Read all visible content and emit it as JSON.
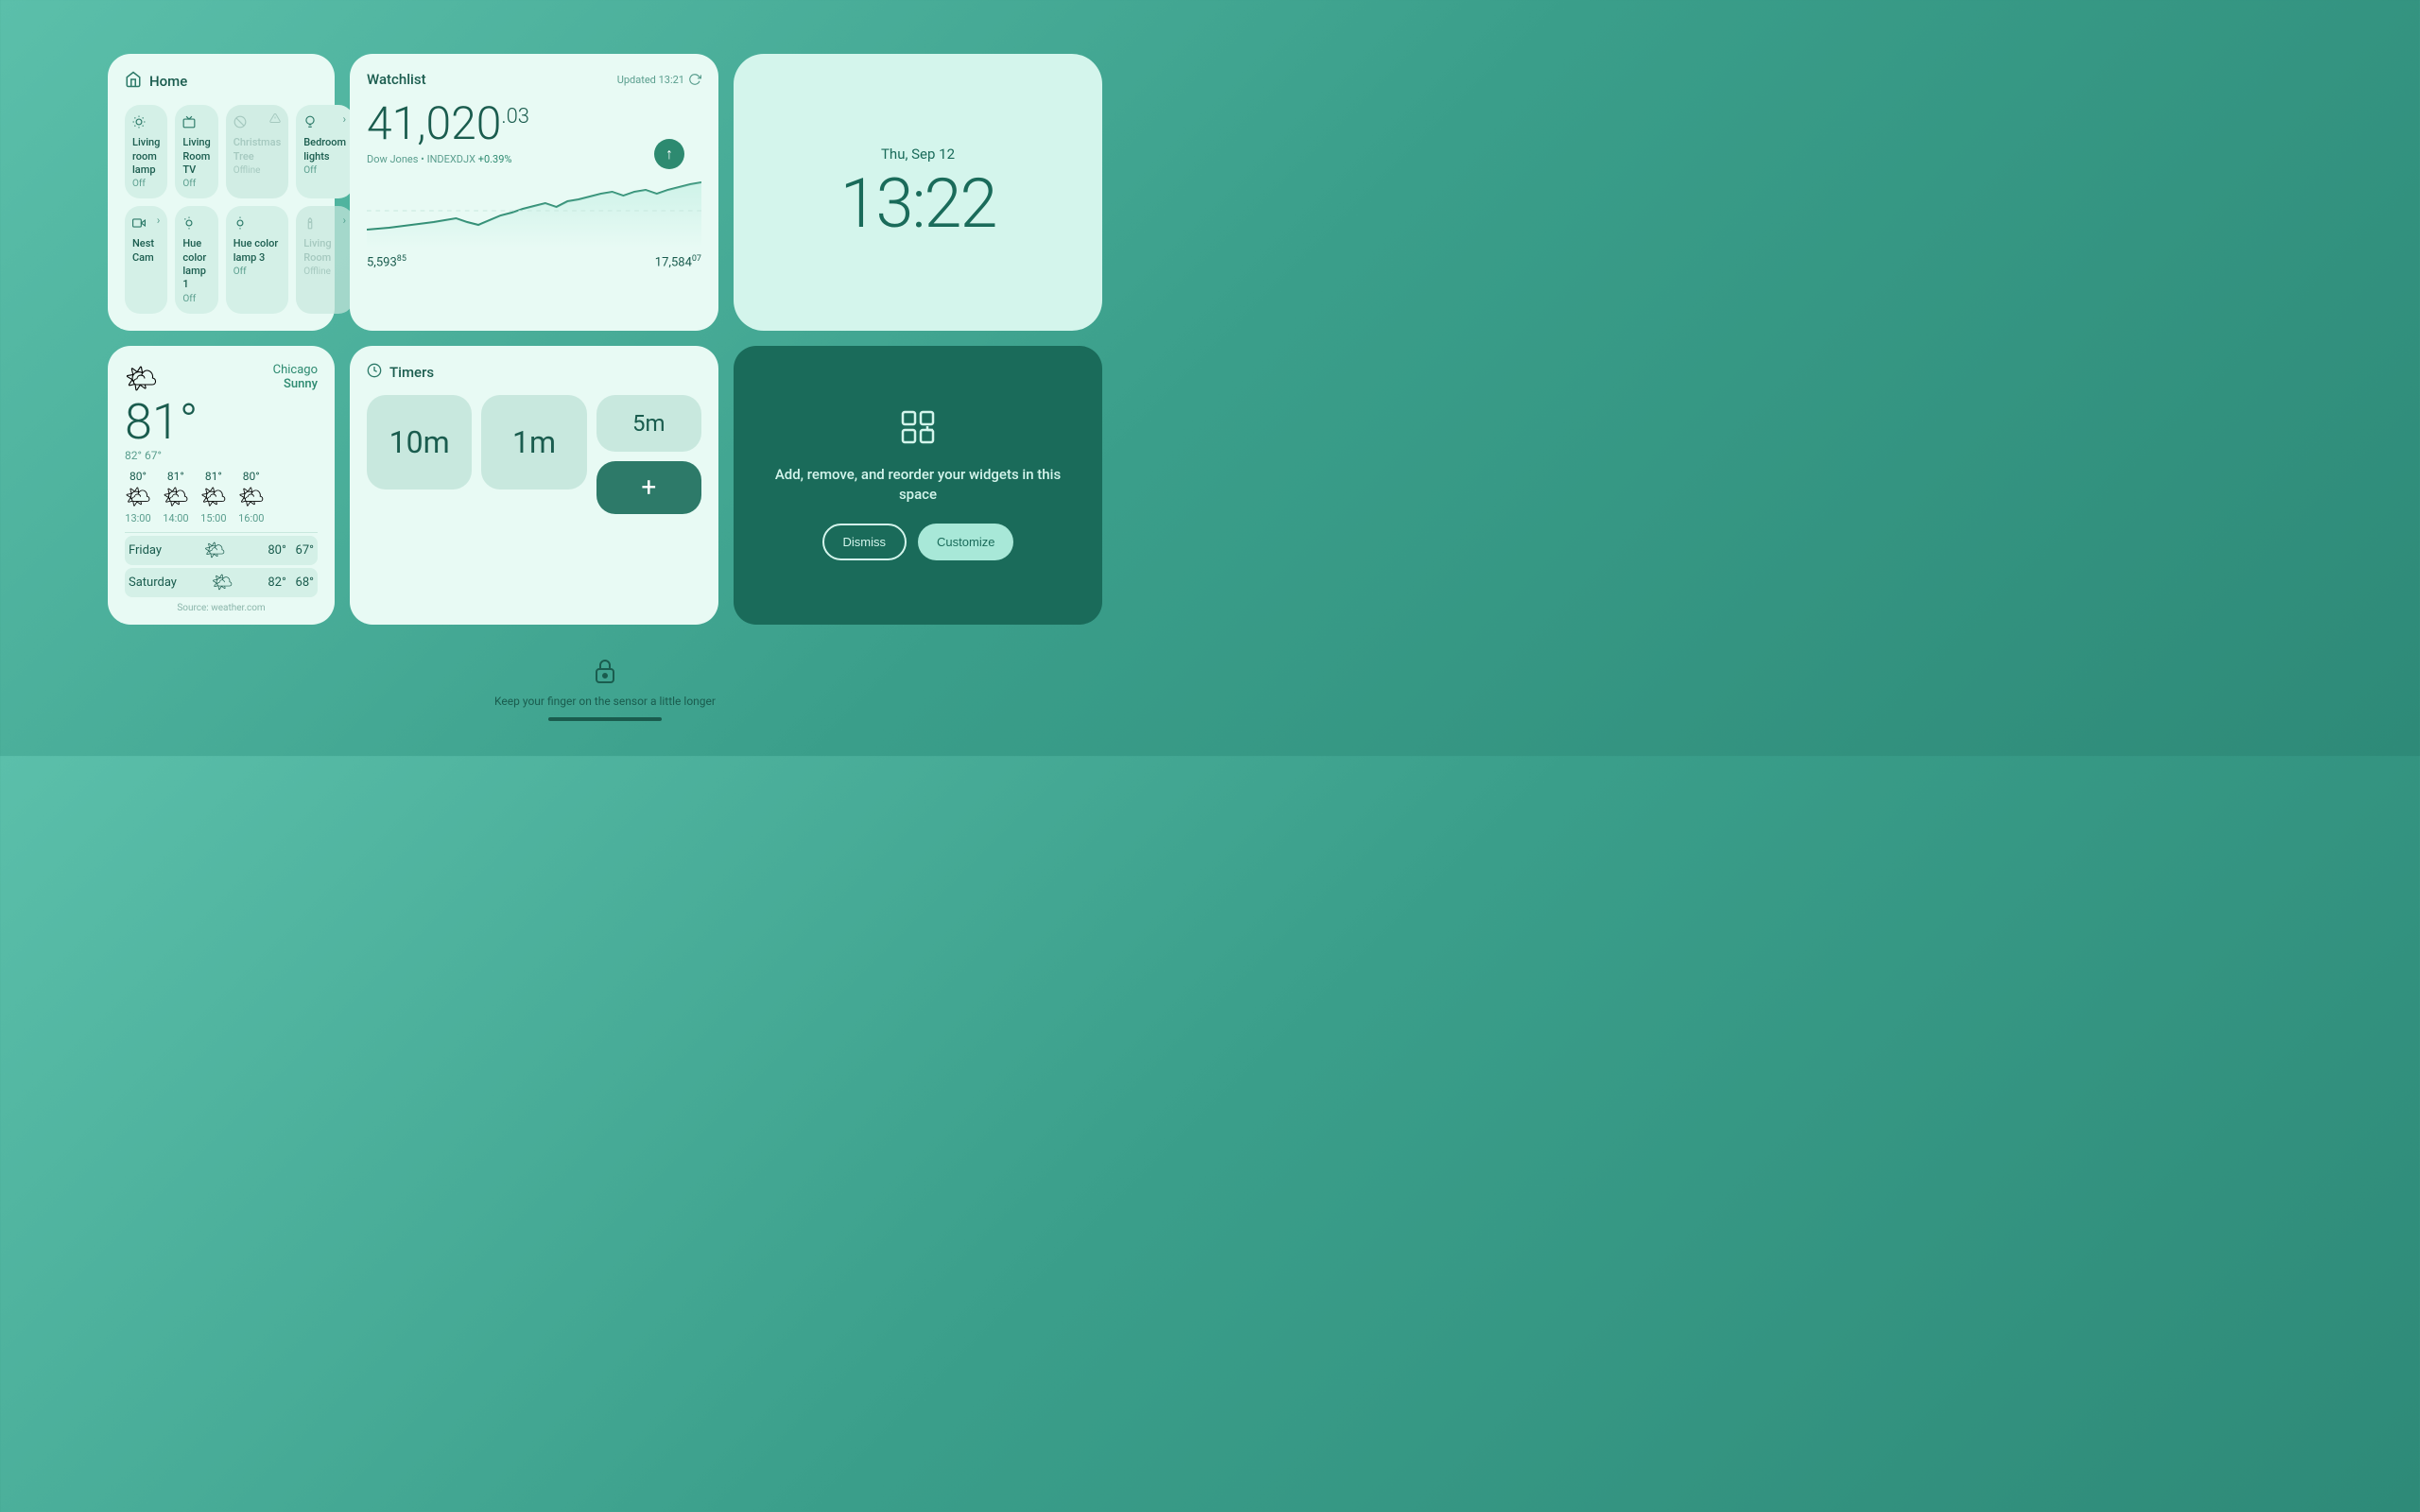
{
  "clock": {
    "date": "Thu, Sep 12",
    "time": "13:22"
  },
  "home": {
    "title": "Home",
    "icon": "🏠",
    "items": [
      {
        "name": "Living room lamp",
        "status": "Off",
        "icon": "💡",
        "offline": false,
        "warning": false,
        "more": false
      },
      {
        "name": "Living Room TV",
        "status": "Off",
        "icon": "📺",
        "offline": false,
        "warning": false,
        "more": false
      },
      {
        "name": "Christmas Tree",
        "status": "Offline",
        "icon": "🔘",
        "offline": true,
        "warning": true,
        "more": false
      },
      {
        "name": "Bedroom lights",
        "status": "Off",
        "icon": "💡",
        "offline": false,
        "warning": false,
        "more": false
      },
      {
        "name": "Nest Cam",
        "status": "",
        "icon": "📹",
        "offline": false,
        "warning": false,
        "more": true
      },
      {
        "name": "Hue color lamp 1",
        "status": "Off",
        "icon": "💡",
        "offline": false,
        "warning": false,
        "more": false
      },
      {
        "name": "Hue color lamp 3",
        "status": "Off",
        "icon": "💡",
        "offline": false,
        "warning": false,
        "more": false
      },
      {
        "name": "Living Room",
        "status": "Offline",
        "icon": "🕯️",
        "offline": true,
        "warning": false,
        "more": false
      }
    ]
  },
  "watchlist": {
    "title": "Watchlist",
    "updated": "Updated 13:21",
    "value_main": "41,020",
    "value_decimal": ".03",
    "stock_label": "Dow Jones • INDEXDJX",
    "stock_change": "+0.39%",
    "sub_values": [
      {
        "value": "5,593",
        "decimal": "85"
      },
      {
        "value": "17,584",
        "decimal": "07"
      }
    ]
  },
  "weather": {
    "city": "Chicago",
    "condition": "Sunny",
    "temp_main": "81°",
    "hi": "82°",
    "lo": "67°",
    "hourly": [
      {
        "temp": "80°",
        "time": "13:00"
      },
      {
        "temp": "81°",
        "time": "14:00"
      },
      {
        "temp": "81°",
        "time": "15:00"
      },
      {
        "temp": "80°",
        "time": "16:00"
      }
    ],
    "forecast": [
      {
        "day": "Friday",
        "hi": "80°",
        "lo": "67°"
      },
      {
        "day": "Saturday",
        "hi": "82°",
        "lo": "68°"
      }
    ],
    "source": "Source: weather.com"
  },
  "timers": {
    "title": "Timers",
    "icon": "⏱",
    "values": [
      "10m",
      "1m",
      "5m"
    ],
    "add_label": "+"
  },
  "customize": {
    "icon": "⊞",
    "text": "Add, remove, and reorder your widgets in this space",
    "dismiss_label": "Dismiss",
    "customize_label": "Customize"
  },
  "bottom": {
    "lock_hint": "Keep your finger on the sensor a little longer"
  }
}
